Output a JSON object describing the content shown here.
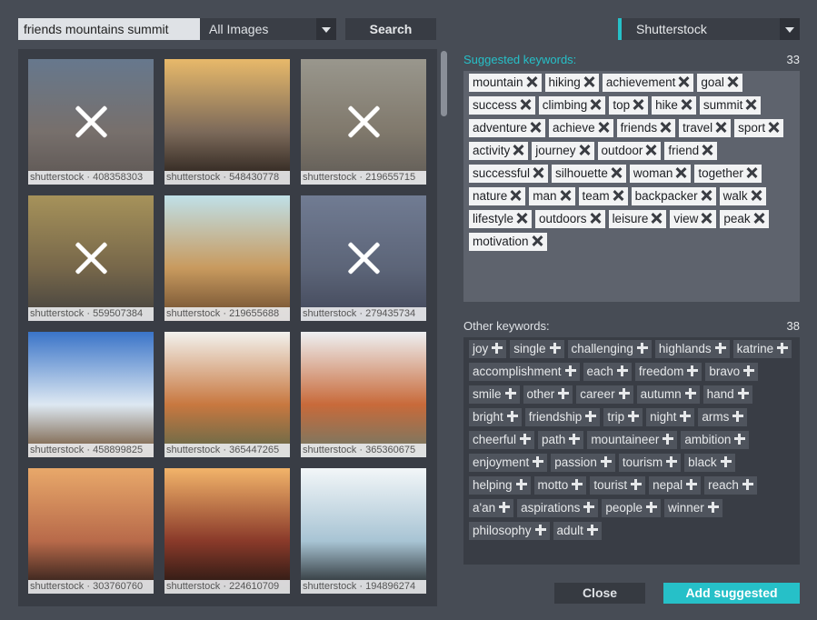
{
  "search": {
    "query": "friends mountains summit"
  },
  "filter": {
    "selected": "All Images"
  },
  "search_button": "Search",
  "provider": {
    "selected": "Shutterstock"
  },
  "images": [
    {
      "caption": "shutterstock · 408358303",
      "excluded": true,
      "palette": [
        "#6d89a6",
        "#8b7a6a",
        "#5a4a3c"
      ]
    },
    {
      "caption": "shutterstock · 548430778",
      "excluded": false,
      "palette": [
        "#e8b96a",
        "#7c6a5a",
        "#221a16"
      ]
    },
    {
      "caption": "shutterstock · 219655715",
      "excluded": true,
      "palette": [
        "#c9c1a6",
        "#9b8a6a",
        "#5e5240"
      ]
    },
    {
      "caption": "shutterstock · 559507384",
      "excluded": true,
      "palette": [
        "#e0b84a",
        "#8a6a2c",
        "#2a2418"
      ]
    },
    {
      "caption": "shutterstock · 219655688",
      "excluded": false,
      "palette": [
        "#bfe0e8",
        "#c89a5e",
        "#6a4a2e"
      ]
    },
    {
      "caption": "shutterstock · 279435734",
      "excluded": true,
      "palette": [
        "#7f8fb0",
        "#5a6680",
        "#2a3048"
      ]
    },
    {
      "caption": "shutterstock · 458899825",
      "excluded": false,
      "palette": [
        "#3a74c8",
        "#dde8f2",
        "#6a4a2a"
      ]
    },
    {
      "caption": "shutterstock · 365447265",
      "excluded": false,
      "palette": [
        "#f2f2ee",
        "#c87840",
        "#58684a"
      ]
    },
    {
      "caption": "shutterstock · 365360675",
      "excluded": false,
      "palette": [
        "#eef0f2",
        "#c86a3a",
        "#6a7a6a"
      ]
    },
    {
      "caption": "shutterstock · 303760760",
      "excluded": false,
      "palette": [
        "#e8a86a",
        "#b86a4a",
        "#1a1414"
      ]
    },
    {
      "caption": "shutterstock · 224610709",
      "excluded": false,
      "palette": [
        "#f2b46a",
        "#8a3a2a",
        "#1a1410"
      ]
    },
    {
      "caption": "shutterstock · 194896274",
      "excluded": false,
      "palette": [
        "#f2f6f8",
        "#a8c4d4",
        "#141618"
      ]
    }
  ],
  "suggested": {
    "label": "Suggested keywords:",
    "count": "33",
    "keywords": [
      "mountain",
      "hiking",
      "achievement",
      "goal",
      "success",
      "climbing",
      "top",
      "hike",
      "summit",
      "adventure",
      "achieve",
      "friends",
      "travel",
      "sport",
      "activity",
      "journey",
      "outdoor",
      "friend",
      "successful",
      "silhouette",
      "woman",
      "together",
      "nature",
      "man",
      "team",
      "backpacker",
      "walk",
      "lifestyle",
      "outdoors",
      "leisure",
      "view",
      "peak",
      "motivation"
    ]
  },
  "other": {
    "label": "Other keywords:",
    "count": "38",
    "keywords": [
      "joy",
      "single",
      "challenging",
      "highlands",
      "katrine",
      "accomplishment",
      "each",
      "freedom",
      "bravo",
      "smile",
      "other",
      "career",
      "autumn",
      "hand",
      "bright",
      "friendship",
      "trip",
      "night",
      "arms",
      "cheerful",
      "path",
      "mountaineer",
      "ambition",
      "enjoyment",
      "passion",
      "tourism",
      "black",
      "helping",
      "motto",
      "tourist",
      "nepal",
      "reach",
      "a'an",
      "aspirations",
      "people",
      "winner",
      "philosophy",
      "adult"
    ]
  },
  "close_button": "Close",
  "add_button": "Add suggested",
  "colors": {
    "accent": "#26c0c8",
    "background": "#474c55",
    "panel": "#393d45"
  }
}
